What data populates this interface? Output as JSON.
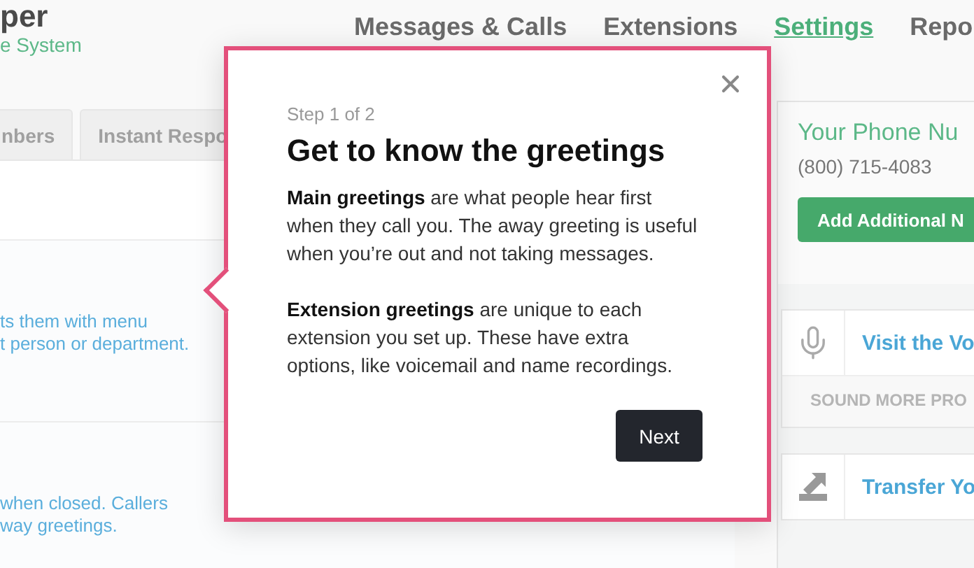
{
  "logo": {
    "name": "per",
    "tagline": "e System"
  },
  "nav": [
    {
      "label": "Messages & Calls",
      "selected": false
    },
    {
      "label": "Extensions",
      "selected": false
    },
    {
      "label": "Settings",
      "selected": true
    },
    {
      "label": "Repo",
      "selected": false
    }
  ],
  "tabs": [
    {
      "label": "nbers",
      "selected": false
    },
    {
      "label": "Instant Respo",
      "selected": false
    }
  ],
  "greeting_cards": [
    {
      "lines": [
        "ts them with menu",
        "t person or department."
      ]
    },
    {
      "lines": [
        "when closed. Callers",
        "way greetings."
      ]
    }
  ],
  "phone_panel": {
    "title": "Your Phone Nu",
    "number": "(800) 715-4083",
    "button": "Add Additional N"
  },
  "feature_cards": [
    {
      "kind": "microphone",
      "title": "Visit the Vo",
      "caption": "SOUND MORE PRO"
    },
    {
      "kind": "transfer",
      "title": "Transfer Yo"
    }
  ],
  "tour_popup": {
    "step": "Step 1 of 2",
    "title": "Get to know the greetings",
    "paragraphs": [
      "**Main greetings** are what people hear first when they call you. The away greeting is useful when you’re out and not taking messages.",
      "**Extension greetings** are unique to each extension you set up. These have extra options, like voicemail and name recordings."
    ],
    "button": "Next"
  }
}
